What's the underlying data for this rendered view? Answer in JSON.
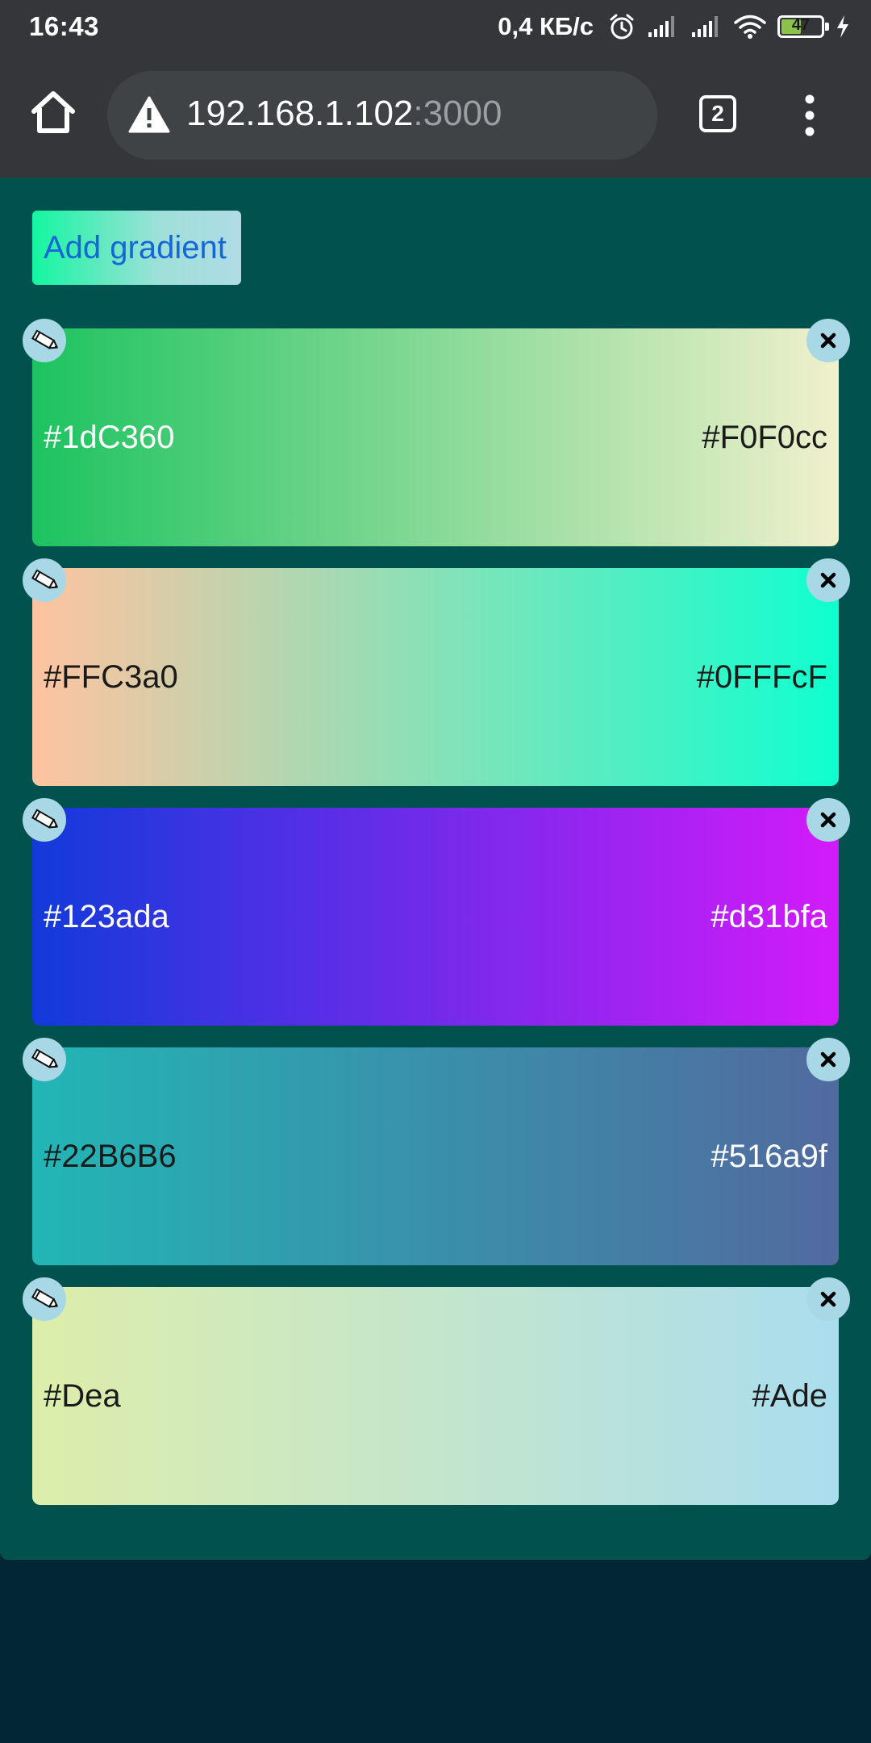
{
  "status_bar": {
    "time": "16:43",
    "network_speed": "0,4 КБ/с",
    "battery_level": "47",
    "icons": [
      "alarm-icon",
      "signal-icon",
      "signal-icon",
      "wifi-icon",
      "battery-icon",
      "charging-icon"
    ]
  },
  "browser": {
    "url_host": "192.168.1.102",
    "url_port": ":3000",
    "tab_count": "2",
    "icons": [
      "home-icon",
      "warning-icon",
      "tabs-icon",
      "more-vert-icon"
    ]
  },
  "page": {
    "add_button_label": "Add gradient",
    "gradients": [
      {
        "start": "#1dC360",
        "end": "#F0F0cc",
        "start_color": "#1dc360",
        "end_color": "#f0f0cc",
        "start_text_color": "#ffffff",
        "end_text_color": "#1a1a1a"
      },
      {
        "start": "#FFC3a0",
        "end": "#0FFFcF",
        "start_color": "#ffc3a0",
        "end_color": "#0fffcf",
        "start_text_color": "#1a1a1a",
        "end_text_color": "#1a1a1a"
      },
      {
        "start": "#123ada",
        "end": "#d31bfa",
        "start_color": "#123ada",
        "end_color": "#d31bfa",
        "start_text_color": "#ffffff",
        "end_text_color": "#ffffff"
      },
      {
        "start": "#22B6B6",
        "end": "#516a9f",
        "start_color": "#22b6b6",
        "end_color": "#516a9f",
        "start_text_color": "#1a1a1a",
        "end_text_color": "#ffffff"
      },
      {
        "start": "#Dea",
        "end": "#Ade",
        "start_color": "#ddeeaa",
        "end_color": "#aaddee",
        "start_text_color": "#1a1a1a",
        "end_text_color": "#1a1a1a"
      }
    ],
    "icons": [
      "pencil-icon",
      "close-icon"
    ]
  }
}
